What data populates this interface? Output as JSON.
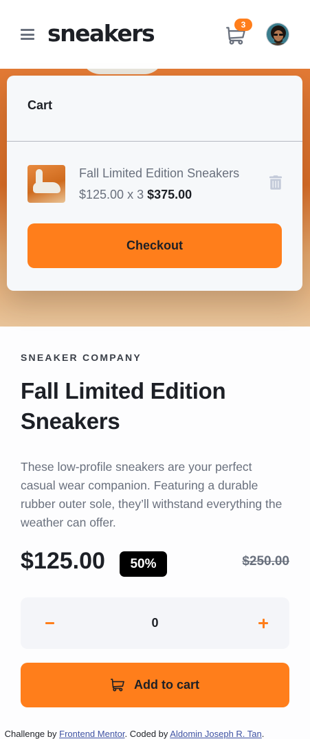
{
  "header": {
    "logo": "sneakers",
    "cart_count": "3",
    "icons": {
      "menu": "menu-icon",
      "cart": "cart-icon",
      "avatar": "avatar-photo"
    }
  },
  "cart": {
    "title": "Cart",
    "item": {
      "name": "Fall Limited Edition Sneakers",
      "unit_price": "$125.00",
      "multiplier": "x 3",
      "total": "$375.00"
    },
    "checkout_label": "Checkout",
    "icons": {
      "delete": "trash-icon"
    }
  },
  "product": {
    "company": "SNEAKER COMPANY",
    "title": "Fall Limited Edition Sneakers",
    "description": "These low-profile sneakers are your perfect casual wear companion. Featuring a durable rubber outer sole, they’ll withstand everything the weather can offer.",
    "price": "$125.00",
    "discount": "50%",
    "old_price": "$250.00"
  },
  "quantity": {
    "value": "0",
    "icons": {
      "minus": "minus-icon",
      "plus": "plus-icon"
    }
  },
  "add_to_cart": {
    "label": "Add to cart",
    "icon": "cart-icon"
  },
  "attribution": {
    "prefix": "Challenge by",
    "link1": "Frontend Mentor",
    "middle": ". Coded by",
    "link2": "Aldomin Joseph R. Tan",
    "suffix": "."
  },
  "colors": {
    "accent": "#ff7e1b",
    "text_dark": "#1d2026",
    "text_gray": "#69707d",
    "badge_black": "#000000"
  }
}
